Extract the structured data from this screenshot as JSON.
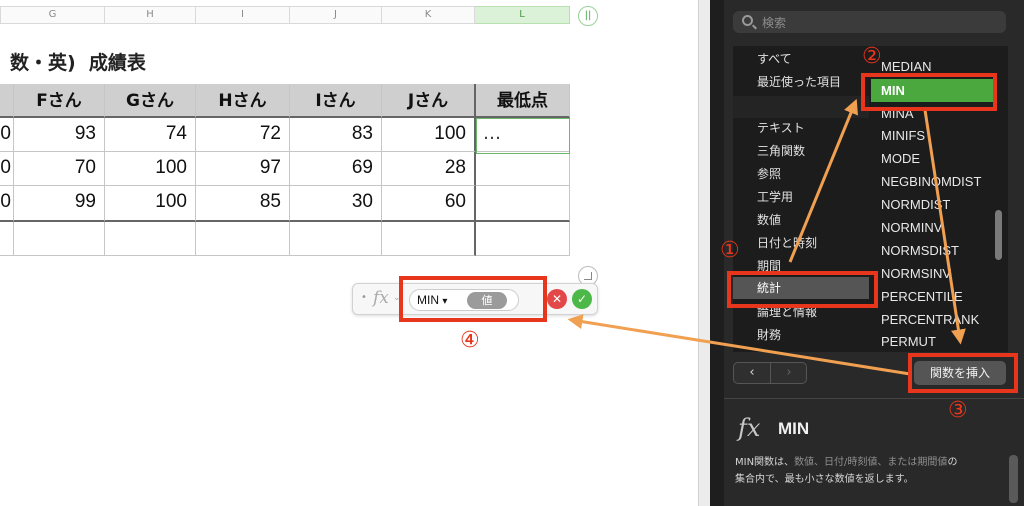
{
  "sheet": {
    "column_headers": [
      {
        "label": "G",
        "active": false
      },
      {
        "label": "H",
        "active": false
      },
      {
        "label": "I",
        "active": false
      },
      {
        "label": "J",
        "active": false
      },
      {
        "label": "K",
        "active": false
      },
      {
        "label": "L",
        "active": true
      }
    ],
    "collapse_icon": "||",
    "title": "数・英)  成績表",
    "table_headers": [
      "Fさん",
      "Gさん",
      "Hさん",
      "Iさん",
      "Jさん",
      "最低点"
    ],
    "left_edge_digit": "0",
    "rows": [
      [
        "93",
        "74",
        "72",
        "83",
        "100"
      ],
      [
        "70",
        "100",
        "97",
        "69",
        "28"
      ],
      [
        "99",
        "100",
        "85",
        "30",
        "60"
      ]
    ],
    "selected_cell_text": "…"
  },
  "formula_bar": {
    "fx_icon": "fx",
    "function_name": "MIN",
    "dropdown_glyph": "▾",
    "argument_token": "値",
    "cancel_glyph": "✕",
    "accept_glyph": "✓"
  },
  "function_browser": {
    "search_placeholder": "検索",
    "categories": [
      {
        "label": "すべて",
        "selected": false
      },
      {
        "label": "最近使った項目",
        "selected": false
      },
      {
        "label": "",
        "selected": false
      },
      {
        "label": "テキスト",
        "selected": false
      },
      {
        "label": "三角関数",
        "selected": false
      },
      {
        "label": "参照",
        "selected": false
      },
      {
        "label": "工学用",
        "selected": false
      },
      {
        "label": "数値",
        "selected": false
      },
      {
        "label": "日付と時刻",
        "selected": false
      },
      {
        "label": "期間",
        "selected": false
      },
      {
        "label": "統計",
        "selected": true
      },
      {
        "label": "論理と情報",
        "selected": false
      },
      {
        "label": "財務",
        "selected": false
      }
    ],
    "functions": [
      {
        "label": "MEDIAN",
        "selected": false
      },
      {
        "label": "MIN",
        "selected": true
      },
      {
        "label": "MINA",
        "selected": false
      },
      {
        "label": "MINIFS",
        "selected": false
      },
      {
        "label": "MODE",
        "selected": false
      },
      {
        "label": "NEGBINOMDIST",
        "selected": false
      },
      {
        "label": "NORMDIST",
        "selected": false
      },
      {
        "label": "NORMINV",
        "selected": false
      },
      {
        "label": "NORMSDIST",
        "selected": false
      },
      {
        "label": "NORMSINV",
        "selected": false
      },
      {
        "label": "PERCENTILE",
        "selected": false
      },
      {
        "label": "PERCENTRANK",
        "selected": false
      },
      {
        "label": "PERMUT",
        "selected": false
      }
    ],
    "nav_prev": "‹",
    "nav_next": "›",
    "insert_button": "関数を挿入",
    "description": {
      "fx_icon": "fx",
      "function_title": "MIN",
      "text_line1_prefix": "MIN関数は、",
      "text_line1_hl": "数値、日付/時刻値、または期間値",
      "text_line1_suffix": "の",
      "text_line2": "集合内で、最も小さな数値を返します。"
    }
  },
  "annotations": {
    "step1": "①",
    "step2": "②",
    "step3": "③",
    "step4": "④",
    "color": "#e8361c",
    "arrow_color": "#f0a050"
  }
}
